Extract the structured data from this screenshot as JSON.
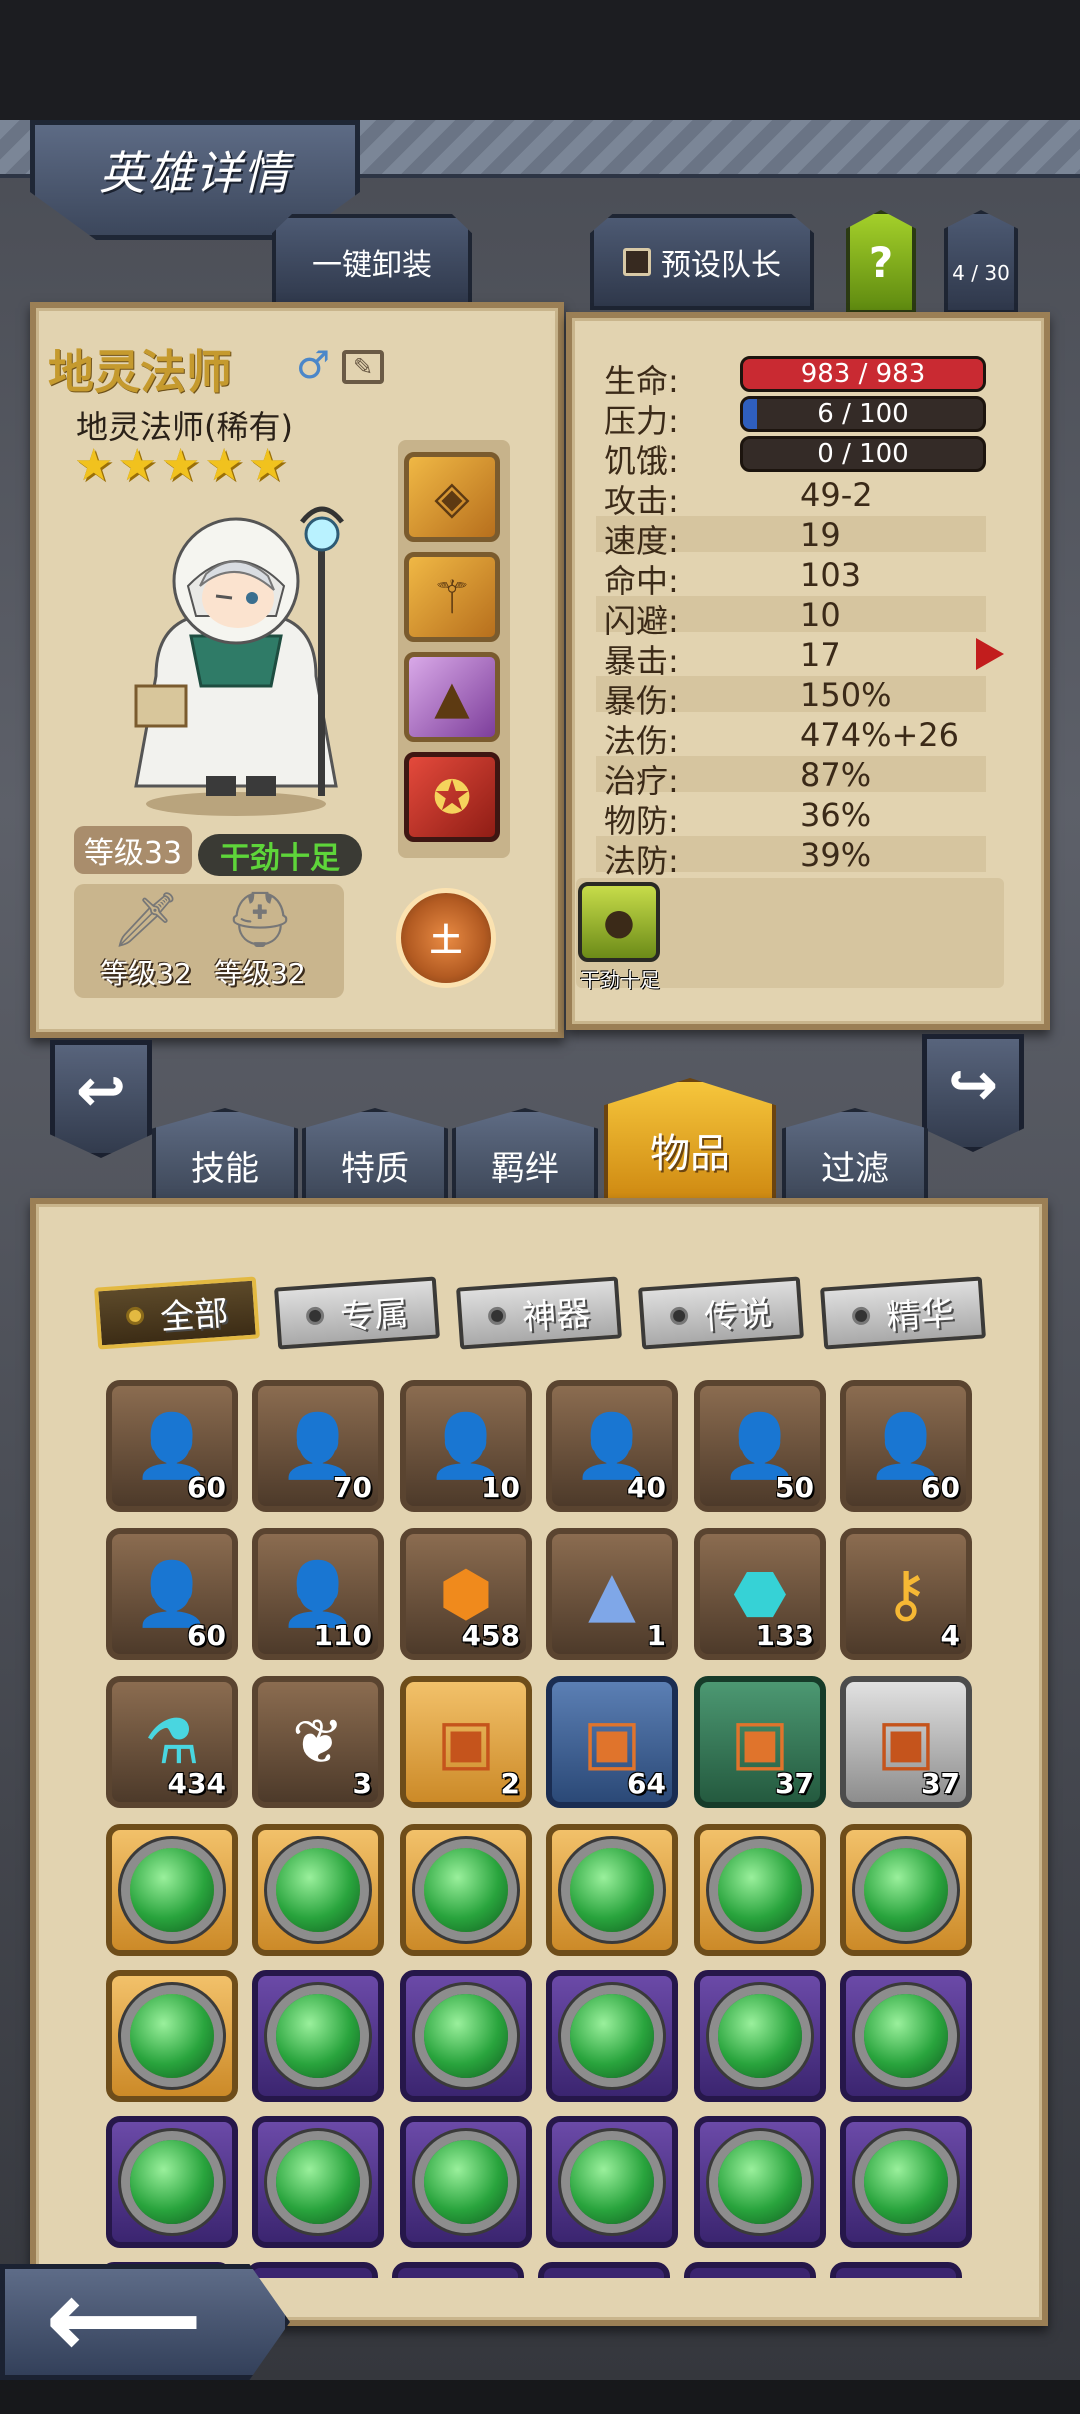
{
  "header": {
    "title": "英雄详情"
  },
  "buttons": {
    "unequip_all": "一键卸装",
    "preset_leader": "预设队长",
    "help": "?",
    "team_count": "4 / 30"
  },
  "hero": {
    "name": "地灵法师",
    "subtitle": "地灵法师(稀有)",
    "stars": 5,
    "level": "等级33",
    "state": "干劲十足",
    "weapon_level": "等级32",
    "armor_level": "等级32",
    "element": "土",
    "gender_symbol": "♂"
  },
  "stats": {
    "hp": {
      "label": "生命:",
      "value": "983 / 983",
      "fraction": 1.0,
      "color": "#c92a32"
    },
    "stress": {
      "label": "压力:",
      "value": "6 / 100",
      "fraction": 0.06,
      "color": "#2f5fbf"
    },
    "hunger": {
      "label": "饥饿:",
      "value": "0 / 100",
      "fraction": 0.0,
      "color": "#e0a000"
    },
    "rows": [
      {
        "label": "攻击:",
        "value": "49-2"
      },
      {
        "label": "速度:",
        "value": "19"
      },
      {
        "label": "命中:",
        "value": "103"
      },
      {
        "label": "闪避:",
        "value": "10"
      },
      {
        "label": "暴击:",
        "value": "17"
      },
      {
        "label": "暴伤:",
        "value": "150%"
      },
      {
        "label": "法伤:",
        "value": "474%+26"
      },
      {
        "label": "治疗:",
        "value": "87%"
      },
      {
        "label": "物防:",
        "value": "36%"
      },
      {
        "label": "法防:",
        "value": "39%"
      }
    ],
    "status_effect": "干劲十足"
  },
  "tabs": [
    {
      "label": "技能"
    },
    {
      "label": "特质"
    },
    {
      "label": "羁绊"
    },
    {
      "label": "物品"
    },
    {
      "label": "过滤"
    }
  ],
  "filters": [
    {
      "label": "全部"
    },
    {
      "label": "专属"
    },
    {
      "label": "神器"
    },
    {
      "label": "传说"
    },
    {
      "label": "精华"
    }
  ],
  "inventory": {
    "row1": [
      {
        "icon": "hero-portrait-icon",
        "count": "60"
      },
      {
        "icon": "hero-portrait-icon",
        "count": "70"
      },
      {
        "icon": "hero-portrait-icon",
        "count": "10"
      },
      {
        "icon": "hero-portrait-icon",
        "count": "40"
      },
      {
        "icon": "hero-portrait-icon",
        "count": "50"
      },
      {
        "icon": "hero-portrait-icon",
        "count": "60"
      }
    ],
    "row2": [
      {
        "icon": "hero-portrait-icon",
        "count": "60"
      },
      {
        "icon": "hero-portrait-icon",
        "count": "110"
      },
      {
        "icon": "amber-crystal-icon",
        "count": "458"
      },
      {
        "icon": "blue-sand-pile-icon",
        "count": "1"
      },
      {
        "icon": "dark-rune-icon",
        "count": "133"
      },
      {
        "icon": "golden-key-icon",
        "count": "4"
      }
    ],
    "row3": [
      {
        "icon": "potion-flask-icon",
        "count": "434"
      },
      {
        "icon": "white-feather-icon",
        "count": "3"
      },
      {
        "icon": "treasure-chest-icon",
        "count": "2"
      },
      {
        "icon": "treasure-chest-icon",
        "count": "64"
      },
      {
        "icon": "treasure-chest-icon",
        "count": "37"
      },
      {
        "icon": "treasure-chest-icon",
        "count": "37"
      }
    ]
  }
}
